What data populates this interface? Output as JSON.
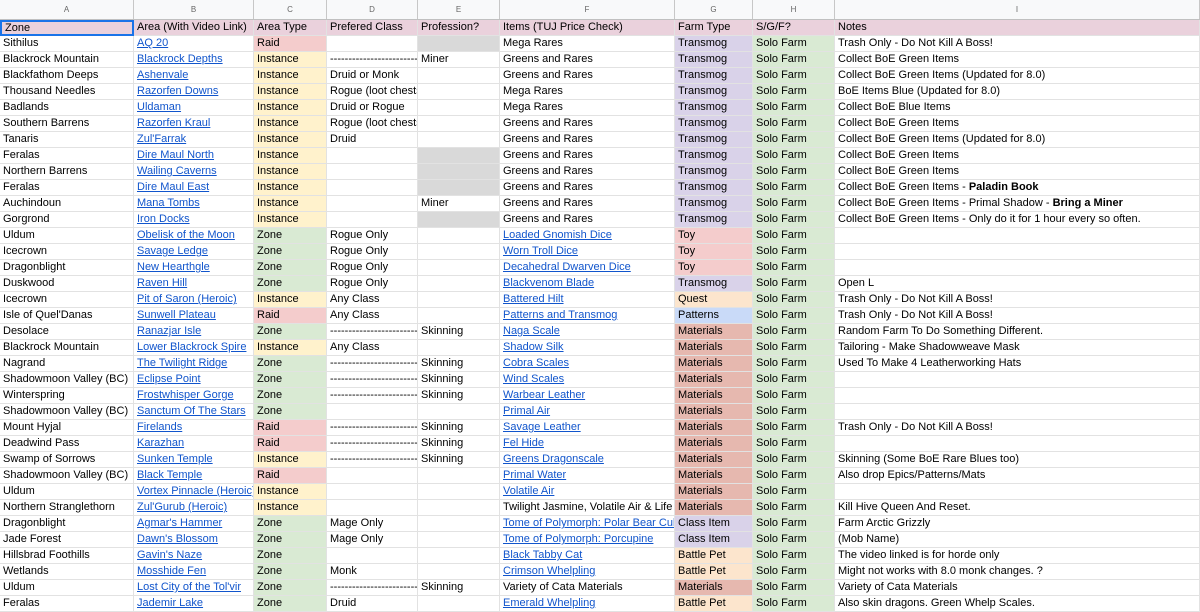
{
  "column_letters": [
    "A",
    "B",
    "C",
    "D",
    "E",
    "F",
    "G",
    "H",
    "I"
  ],
  "headers": [
    "Zone",
    "Area (With Video Link)",
    "Area Type",
    "Prefered Class",
    "Profession?",
    "Items (TUJ Price Check)",
    "Farm Type",
    "S/G/F?",
    "Notes"
  ],
  "colors": {
    "raid": "#f4cccc",
    "instance": "#fff2cc",
    "zone": "#d9ead3",
    "header": "#ead1dc",
    "link": "#1155cc",
    "selection": "#1a73e8"
  },
  "rows": [
    {
      "zone": "Sithilus",
      "area": "AQ 20",
      "type": "Raid",
      "class": "",
      "prof": "",
      "item": "Mega Rares",
      "item_link": false,
      "farm": "Transmog",
      "sgf": "Solo Farm",
      "notes": "Trash Only - Do Not Kill A Boss!"
    },
    {
      "zone": "Blackrock Mountain",
      "area": "Blackrock Depths",
      "type": "Instance",
      "class": "------------------------>",
      "prof": "Miner",
      "item": "Greens and Rares",
      "item_link": false,
      "farm": "Transmog",
      "sgf": "Solo Farm",
      "notes": "Collect BoE Green Items"
    },
    {
      "zone": "Blackfathom Deeps",
      "area": "Ashenvale",
      "type": "Instance",
      "class": "Druid or Monk",
      "prof": "",
      "item": "Greens and Rares",
      "item_link": false,
      "farm": "Transmog",
      "sgf": "Solo Farm",
      "notes": "Collect BoE Green Items  (Updated for 8.0)"
    },
    {
      "zone": "Thousand Needles",
      "area": "Razorfen Downs",
      "type": "Instance",
      "class": "Rogue (loot chests)",
      "prof": "",
      "item": "Mega Rares",
      "item_link": false,
      "farm": "Transmog",
      "sgf": "Solo Farm",
      "notes": "BoE Items Blue (Updated for 8.0)"
    },
    {
      "zone": "Badlands",
      "area": "Uldaman",
      "type": "Instance",
      "class": "Druid or Rogue",
      "prof": "",
      "item": "Mega Rares",
      "item_link": false,
      "farm": "Transmog",
      "sgf": "Solo Farm",
      "notes": "Collect BoE Blue Items"
    },
    {
      "zone": "Southern Barrens",
      "area": "Razorfen Kraul",
      "type": "Instance",
      "class": "Rogue (loot chests)",
      "prof": "",
      "item": "Greens and Rares",
      "item_link": false,
      "farm": "Transmog",
      "sgf": "Solo Farm",
      "notes": "Collect BoE Green Items"
    },
    {
      "zone": "Tanaris",
      "area": "Zul'Farrak",
      "type": "Instance",
      "class": "Druid",
      "prof": "",
      "item": "Greens and Rares",
      "item_link": false,
      "farm": "Transmog",
      "sgf": "Solo Farm",
      "notes": "Collect BoE Green Items (Updated for 8.0)"
    },
    {
      "zone": "Feralas",
      "area": "Dire Maul North",
      "type": "Instance",
      "class": "",
      "prof": "",
      "item": "Greens and Rares",
      "item_link": false,
      "farm": "Transmog",
      "sgf": "Solo Farm",
      "notes": "Collect BoE Green Items"
    },
    {
      "zone": "Northern Barrens",
      "area": "Wailing Caverns",
      "type": "Instance",
      "class": "",
      "prof": "",
      "item": "Greens and Rares",
      "item_link": false,
      "farm": "Transmog",
      "sgf": "Solo Farm",
      "notes": "Collect BoE Green Items"
    },
    {
      "zone": "Feralas",
      "area": "Dire Maul East",
      "type": "Instance",
      "class": "",
      "prof": "",
      "item": "Greens and Rares",
      "item_link": false,
      "farm": "Transmog",
      "sgf": "Solo Farm",
      "notes": "Collect BoE Green Items - ",
      "notes_bold": "Paladin Book"
    },
    {
      "zone": "Auchindoun",
      "area": "Mana Tombs",
      "type": "Instance",
      "class": "",
      "prof": "Miner",
      "item": "Greens and Rares",
      "item_link": false,
      "farm": "Transmog",
      "sgf": "Solo Farm",
      "notes": "Collect BoE Green Items - Primal Shadow -  ",
      "notes_bold": "Bring a Miner"
    },
    {
      "zone": "Gorgrond",
      "area": "Iron Docks",
      "type": "Instance",
      "class": "",
      "prof": "",
      "item": "Greens and Rares",
      "item_link": false,
      "farm": "Transmog",
      "sgf": "Solo Farm",
      "notes": "Collect BoE Green Items - Only do it for 1 hour every so often."
    },
    {
      "zone": "Uldum",
      "area": "Obelisk of the Moon",
      "type": "Zone",
      "class": "Rogue Only",
      "prof": "",
      "item": "Loaded Gnomish Dice",
      "item_link": true,
      "farm": "Toy",
      "sgf": "Solo Farm",
      "notes": ""
    },
    {
      "zone": "Icecrown",
      "area": "Savage Ledge",
      "type": "Zone",
      "class": "Rogue Only",
      "prof": "",
      "item": "Worn Troll Dice",
      "item_link": true,
      "farm": "Toy",
      "sgf": "Solo Farm",
      "notes": ""
    },
    {
      "zone": "Dragonblight",
      "area": "New Hearthgle",
      "type": "Zone",
      "class": "Rogue Only",
      "prof": "",
      "item": "Decahedral Dwarven Dice",
      "item_link": true,
      "farm": "Toy",
      "sgf": "Solo Farm",
      "notes": ""
    },
    {
      "zone": "Duskwood",
      "area": "Raven Hill",
      "type": "Zone",
      "class": "Rogue Only",
      "prof": "",
      "item": "Blackvenom Blade",
      "item_link": true,
      "farm": "Transmog",
      "sgf": "Solo Farm",
      "notes": "Open L"
    },
    {
      "zone": "Icecrown",
      "area": "Pit of Saron (Heroic)",
      "type": "Instance",
      "class": "Any Class",
      "prof": "",
      "item": "Battered Hilt",
      "item_link": true,
      "farm": "Quest",
      "sgf": "Solo Farm",
      "notes": "Trash Only - Do Not Kill A Boss!"
    },
    {
      "zone": "Isle of Quel'Danas",
      "area": "Sunwell Plateau",
      "type": "Raid",
      "class": "Any Class",
      "prof": "",
      "item": "Patterns and Transmog",
      "item_link": true,
      "farm": "Patterns",
      "sgf": "Solo Farm",
      "notes": "Trash Only - Do Not Kill A Boss!"
    },
    {
      "zone": "Desolace",
      "area": "Ranazjar Isle",
      "type": "Zone",
      "class": "------------------------>",
      "prof": "Skinning",
      "item": "Naga Scale",
      "item_link": true,
      "farm": "Materials",
      "sgf": "Solo Farm",
      "notes": "Random Farm To Do Something Different."
    },
    {
      "zone": "Blackrock Mountain",
      "area": "Lower Blackrock Spire",
      "type": "Instance",
      "class": "Any Class",
      "prof": "",
      "item": "Shadow Silk",
      "item_link": true,
      "farm": "Materials",
      "sgf": "Solo Farm",
      "notes": "Tailoring - Make Shadowweave Mask"
    },
    {
      "zone": "Nagrand",
      "area": "The Twilight Ridge",
      "type": "Zone",
      "class": "------------------------>",
      "prof": "Skinning",
      "item": "Cobra Scales",
      "item_link": true,
      "farm": "Materials",
      "sgf": "Solo Farm",
      "notes": "Used To Make 4 Leatherworking Hats"
    },
    {
      "zone": "Shadowmoon Valley (BC)",
      "area": "Eclipse Point",
      "type": "Zone",
      "class": "------------------------>",
      "prof": "Skinning",
      "item": "Wind Scales",
      "item_link": true,
      "farm": "Materials",
      "sgf": "Solo Farm",
      "notes": ""
    },
    {
      "zone": "Winterspring",
      "area": "Frostwhisper Gorge",
      "type": "Zone",
      "class": "------------------------>",
      "prof": "Skinning",
      "item": "Warbear Leather",
      "item_link": true,
      "farm": "Materials",
      "sgf": "Solo Farm",
      "notes": ""
    },
    {
      "zone": "Shadowmoon Valley (BC)",
      "area": "Sanctum Of The Stars",
      "type": "Zone",
      "class": "",
      "prof": "",
      "item": "Primal Air",
      "item_link": true,
      "farm": "Materials",
      "sgf": "Solo Farm",
      "notes": ""
    },
    {
      "zone": "Mount Hyjal",
      "area": "Firelands",
      "type": "Raid",
      "class": "------------------------>",
      "prof": "Skinning",
      "item": "Savage Leather",
      "item_link": true,
      "farm": "Materials",
      "sgf": "Solo Farm",
      "notes": "Trash Only - Do Not Kill A Boss!"
    },
    {
      "zone": "Deadwind Pass",
      "area": "Karazhan",
      "type": "Raid",
      "class": "------------------------>",
      "prof": "Skinning",
      "item": "Fel Hide",
      "item_link": true,
      "farm": "Materials",
      "sgf": "Solo Farm",
      "notes": ""
    },
    {
      "zone": "Swamp of Sorrows",
      "area": "Sunken Temple",
      "type": "Instance",
      "class": "------------------------>",
      "prof": "Skinning",
      "item": "Greens Dragonscale",
      "item_link": true,
      "farm": "Materials",
      "sgf": "Solo Farm",
      "notes": "Skinning (Some BoE Rare Blues too)"
    },
    {
      "zone": "Shadowmoon Valley (BC)",
      "area": "Black Temple",
      "type": "Raid",
      "class": "",
      "prof": "",
      "item": "Primal Water",
      "item_link": true,
      "farm": "Materials",
      "sgf": "Solo Farm",
      "notes": "Also drop Epics/Patterns/Mats"
    },
    {
      "zone": "Uldum",
      "area": "Vortex Pinnacle (Heroic)",
      "type": "Instance",
      "class": "",
      "prof": "",
      "item": "Volatile Air",
      "item_link": true,
      "farm": "Materials",
      "sgf": "Solo Farm",
      "notes": ""
    },
    {
      "zone": "Northern Stranglethorn",
      "area": "Zul'Gurub (Heroic)",
      "type": "Instance",
      "class": "",
      "prof": "",
      "item": "Twilight Jasmine, Volatile Air & Life",
      "item_link": false,
      "farm": "Materials",
      "sgf": "Solo Farm",
      "notes": "Kill Hive Queen And Reset."
    },
    {
      "zone": "Dragonblight",
      "area": "Agmar's Hammer",
      "type": "Zone",
      "class": "Mage Only",
      "prof": "",
      "item": "Tome of Polymorph: Polar Bear Cub",
      "item_link": true,
      "farm": "Class Item",
      "sgf": "Solo Farm",
      "notes": "Farm Arctic Grizzly"
    },
    {
      "zone": "Jade Forest",
      "area": "Dawn's Blossom",
      "type": "Zone",
      "class": "Mage Only",
      "prof": "",
      "item": "Tome of Polymorph: Porcupine",
      "item_link": true,
      "farm": "Class Item",
      "sgf": "Solo Farm",
      "notes": "(Mob Name)"
    },
    {
      "zone": "Hillsbrad Foothills",
      "area": "Gavin's Naze",
      "type": "Zone",
      "class": "",
      "prof": "",
      "item": "Black Tabby Cat",
      "item_link": true,
      "farm": "Battle Pet",
      "sgf": "Solo Farm",
      "notes": "The video linked is for horde only"
    },
    {
      "zone": "Wetlands",
      "area": "Mosshide Fen",
      "type": "Zone",
      "class": "Monk",
      "prof": "",
      "item": "Crimson Whelpling",
      "item_link": true,
      "farm": "Battle Pet",
      "sgf": "Solo Farm",
      "notes": "Might not works with 8.0 monk changes. ?"
    },
    {
      "zone": "Uldum",
      "area": "Lost City of the Tol'vir",
      "type": "Zone",
      "class": "------------------------>",
      "prof": "Skinning",
      "item": "Variety of Cata Materials",
      "item_link": false,
      "farm": "Materials",
      "sgf": "Solo Farm",
      "notes": "Variety of Cata Materials"
    },
    {
      "zone": "Feralas",
      "area": "Jademir Lake",
      "type": "Zone",
      "class": "Druid",
      "prof": "",
      "item": "Emerald Whelpling",
      "item_link": true,
      "farm": "Battle Pet",
      "sgf": "Solo Farm",
      "notes": "Also skin dragons. Green Whelp Scales."
    }
  ]
}
